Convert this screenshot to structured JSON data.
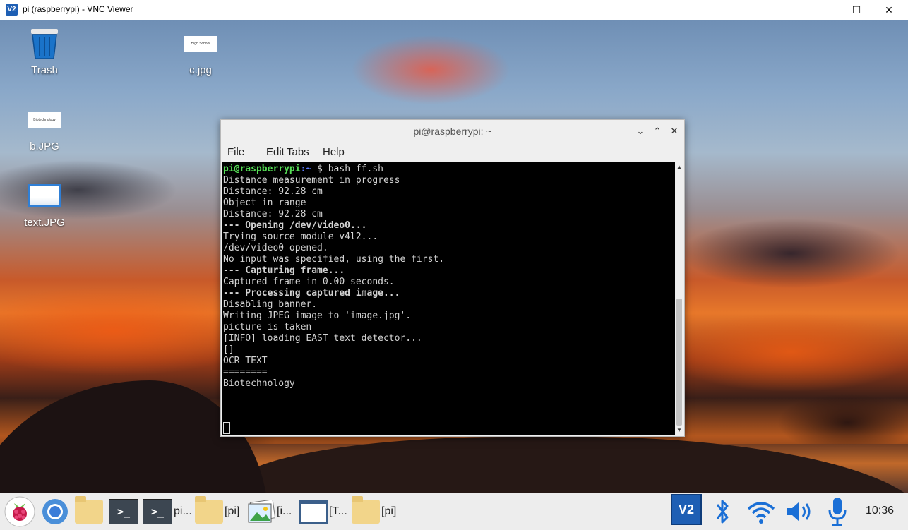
{
  "vnc_window": {
    "logo": "V2",
    "title": "pi (raspberrypi) - VNC Viewer",
    "minimize_icon": "—",
    "maximize_icon": "☐",
    "close_icon": "✕"
  },
  "desktop": {
    "icons": [
      {
        "name": "trash-icon",
        "label": "Trash"
      },
      {
        "name": "c-jpg-file",
        "label": "c.jpg",
        "thumb_text": "High School"
      },
      {
        "name": "b-jpg-file",
        "label": "b.JPG",
        "thumb_text": "Biotechnology"
      },
      {
        "name": "text-jpg-file",
        "label": "text.JPG"
      }
    ]
  },
  "terminal": {
    "title": "pi@raspberrypi: ~",
    "controls": {
      "minimize": "⌄",
      "maximize": "⌃",
      "close": "✕"
    },
    "menu": [
      "File",
      "Edit",
      "Tabs",
      "Help"
    ],
    "prompt": {
      "user": "pi@raspberrypi",
      "path": ":~",
      "dollar": " $ ",
      "command": "bash ff.sh"
    },
    "lines": [
      {
        "text": "Distance measurement in progress",
        "bold": false
      },
      {
        "text": "Distance: 92.28 cm",
        "bold": false
      },
      {
        "text": "Object in range",
        "bold": false
      },
      {
        "text": "Distance: 92.28 cm",
        "bold": false
      },
      {
        "text": "--- Opening /dev/video0...",
        "bold": true
      },
      {
        "text": "Trying source module v4l2...",
        "bold": false
      },
      {
        "text": "/dev/video0 opened.",
        "bold": false
      },
      {
        "text": "No input was specified, using the first.",
        "bold": false
      },
      {
        "text": "--- Capturing frame...",
        "bold": true
      },
      {
        "text": "Captured frame in 0.00 seconds.",
        "bold": false
      },
      {
        "text": "--- Processing captured image...",
        "bold": true
      },
      {
        "text": "Disabling banner.",
        "bold": false
      },
      {
        "text": "Writing JPEG image to 'image.jpg'.",
        "bold": false
      },
      {
        "text": "picture is taken",
        "bold": false
      },
      {
        "text": "[INFO] loading EAST text detector...",
        "bold": false
      },
      {
        "text": "[]",
        "bold": false
      },
      {
        "text": "OCR TEXT",
        "bold": false
      },
      {
        "text": "========",
        "bold": false
      },
      {
        "text": "Biotechnology",
        "bold": false
      }
    ]
  },
  "taskbar": {
    "items": [
      {
        "name": "raspberry-menu-icon"
      },
      {
        "name": "chromium-icon"
      },
      {
        "name": "file-manager-icon"
      },
      {
        "name": "terminal-launcher-icon",
        "glyph": ">_"
      },
      {
        "name": "task-terminal-pi",
        "glyph": ">_",
        "label": "pi..."
      },
      {
        "name": "task-folder-pi-1",
        "label": "[pi]"
      },
      {
        "name": "task-image-viewer",
        "label": "[i..."
      },
      {
        "name": "task-text-window",
        "label": "[T..."
      },
      {
        "name": "task-folder-pi-2",
        "label": "[pi]"
      }
    ],
    "tray": {
      "vnc": "V2",
      "bluetooth": "bluetooth-icon",
      "wifi": "wifi-icon",
      "volume": "volume-icon",
      "mic": "microphone-icon",
      "clock": "10:36"
    }
  }
}
